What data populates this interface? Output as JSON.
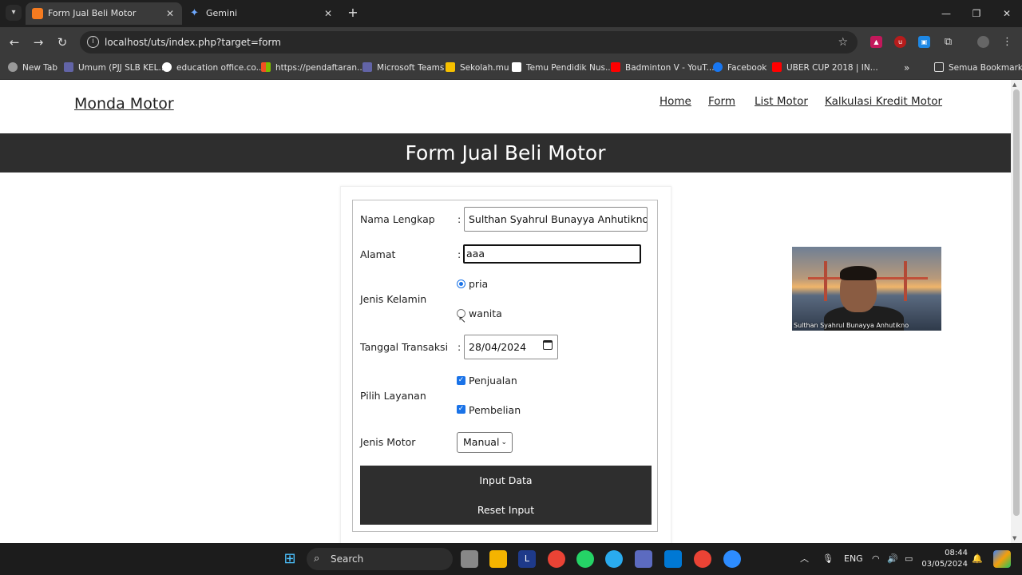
{
  "browser": {
    "tabs": [
      {
        "title": "Form Jual Beli Motor",
        "icon": "xampp-icon",
        "active": true
      },
      {
        "title": "Gemini",
        "icon": "gemini-sparkle-icon",
        "active": false
      }
    ],
    "url": "localhost/uts/index.php?target=form",
    "bookmarks": [
      "New Tab",
      "Umum (PJJ SLB KEL...",
      "education office.co...",
      "https://pendaftaran...",
      "Microsoft Teams",
      "Sekolah.mu",
      "Temu Pendidik Nus...",
      "Badminton V - YouT...",
      "Facebook",
      "UBER CUP 2018 | IN..."
    ],
    "bookmarks_folder": "Semua Bookmark"
  },
  "site": {
    "brand": "Monda Motor",
    "nav": [
      "Home",
      "Form",
      "List Motor",
      "Kalkulasi Kredit Motor"
    ],
    "banner_title": "Form Jual Beli Motor"
  },
  "form": {
    "nama_label": "Nama Lengkap",
    "nama_value": "Sulthan Syahrul Bunayya Anhutikno a",
    "alamat_label": "Alamat",
    "alamat_value": "aaa",
    "gender_label": "Jenis Kelamin",
    "gender_options": [
      "pria",
      "wanita"
    ],
    "gender_selected": "pria",
    "tanggal_label": "Tanggal Transaksi",
    "tanggal_value": "28/04/2024",
    "layanan_label": "Pilih Layanan",
    "layanan_options": [
      "Penjualan",
      "Pembelian"
    ],
    "layanan_checked": [
      true,
      true
    ],
    "motor_label": "Jenis Motor",
    "motor_selected": "Manual",
    "colon": ":",
    "submit_label": "Input Data",
    "reset_label": "Reset Input"
  },
  "webcam": {
    "caption": "Sulthan Syahrul Bunayya Anhutikno"
  },
  "taskbar": {
    "search_placeholder": "Search",
    "language": "ENG",
    "time": "08:44",
    "date": "03/05/2024"
  },
  "colors": {
    "banner_bg": "#2e2e2e",
    "accent": "#1a73e8",
    "browser_chrome": "#3a3a3a"
  }
}
